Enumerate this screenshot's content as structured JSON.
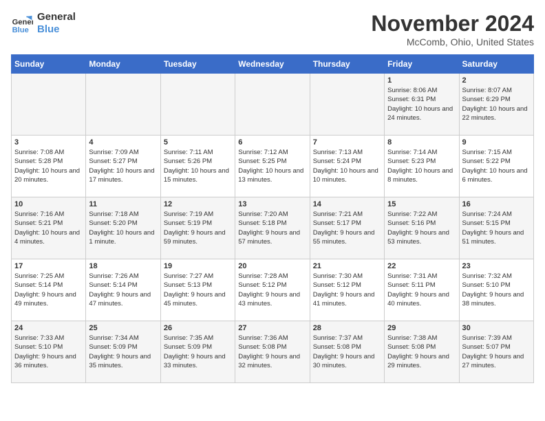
{
  "header": {
    "logo_line1": "General",
    "logo_line2": "Blue",
    "title": "November 2024",
    "subtitle": "McComb, Ohio, United States"
  },
  "calendar": {
    "days_of_week": [
      "Sunday",
      "Monday",
      "Tuesday",
      "Wednesday",
      "Thursday",
      "Friday",
      "Saturday"
    ],
    "weeks": [
      [
        {
          "day": "",
          "info": ""
        },
        {
          "day": "",
          "info": ""
        },
        {
          "day": "",
          "info": ""
        },
        {
          "day": "",
          "info": ""
        },
        {
          "day": "",
          "info": ""
        },
        {
          "day": "1",
          "info": "Sunrise: 8:06 AM\nSunset: 6:31 PM\nDaylight: 10 hours and 24 minutes."
        },
        {
          "day": "2",
          "info": "Sunrise: 8:07 AM\nSunset: 6:29 PM\nDaylight: 10 hours and 22 minutes."
        }
      ],
      [
        {
          "day": "3",
          "info": "Sunrise: 7:08 AM\nSunset: 5:28 PM\nDaylight: 10 hours and 20 minutes."
        },
        {
          "day": "4",
          "info": "Sunrise: 7:09 AM\nSunset: 5:27 PM\nDaylight: 10 hours and 17 minutes."
        },
        {
          "day": "5",
          "info": "Sunrise: 7:11 AM\nSunset: 5:26 PM\nDaylight: 10 hours and 15 minutes."
        },
        {
          "day": "6",
          "info": "Sunrise: 7:12 AM\nSunset: 5:25 PM\nDaylight: 10 hours and 13 minutes."
        },
        {
          "day": "7",
          "info": "Sunrise: 7:13 AM\nSunset: 5:24 PM\nDaylight: 10 hours and 10 minutes."
        },
        {
          "day": "8",
          "info": "Sunrise: 7:14 AM\nSunset: 5:23 PM\nDaylight: 10 hours and 8 minutes."
        },
        {
          "day": "9",
          "info": "Sunrise: 7:15 AM\nSunset: 5:22 PM\nDaylight: 10 hours and 6 minutes."
        }
      ],
      [
        {
          "day": "10",
          "info": "Sunrise: 7:16 AM\nSunset: 5:21 PM\nDaylight: 10 hours and 4 minutes."
        },
        {
          "day": "11",
          "info": "Sunrise: 7:18 AM\nSunset: 5:20 PM\nDaylight: 10 hours and 1 minute."
        },
        {
          "day": "12",
          "info": "Sunrise: 7:19 AM\nSunset: 5:19 PM\nDaylight: 9 hours and 59 minutes."
        },
        {
          "day": "13",
          "info": "Sunrise: 7:20 AM\nSunset: 5:18 PM\nDaylight: 9 hours and 57 minutes."
        },
        {
          "day": "14",
          "info": "Sunrise: 7:21 AM\nSunset: 5:17 PM\nDaylight: 9 hours and 55 minutes."
        },
        {
          "day": "15",
          "info": "Sunrise: 7:22 AM\nSunset: 5:16 PM\nDaylight: 9 hours and 53 minutes."
        },
        {
          "day": "16",
          "info": "Sunrise: 7:24 AM\nSunset: 5:15 PM\nDaylight: 9 hours and 51 minutes."
        }
      ],
      [
        {
          "day": "17",
          "info": "Sunrise: 7:25 AM\nSunset: 5:14 PM\nDaylight: 9 hours and 49 minutes."
        },
        {
          "day": "18",
          "info": "Sunrise: 7:26 AM\nSunset: 5:14 PM\nDaylight: 9 hours and 47 minutes."
        },
        {
          "day": "19",
          "info": "Sunrise: 7:27 AM\nSunset: 5:13 PM\nDaylight: 9 hours and 45 minutes."
        },
        {
          "day": "20",
          "info": "Sunrise: 7:28 AM\nSunset: 5:12 PM\nDaylight: 9 hours and 43 minutes."
        },
        {
          "day": "21",
          "info": "Sunrise: 7:30 AM\nSunset: 5:12 PM\nDaylight: 9 hours and 41 minutes."
        },
        {
          "day": "22",
          "info": "Sunrise: 7:31 AM\nSunset: 5:11 PM\nDaylight: 9 hours and 40 minutes."
        },
        {
          "day": "23",
          "info": "Sunrise: 7:32 AM\nSunset: 5:10 PM\nDaylight: 9 hours and 38 minutes."
        }
      ],
      [
        {
          "day": "24",
          "info": "Sunrise: 7:33 AM\nSunset: 5:10 PM\nDaylight: 9 hours and 36 minutes."
        },
        {
          "day": "25",
          "info": "Sunrise: 7:34 AM\nSunset: 5:09 PM\nDaylight: 9 hours and 35 minutes."
        },
        {
          "day": "26",
          "info": "Sunrise: 7:35 AM\nSunset: 5:09 PM\nDaylight: 9 hours and 33 minutes."
        },
        {
          "day": "27",
          "info": "Sunrise: 7:36 AM\nSunset: 5:08 PM\nDaylight: 9 hours and 32 minutes."
        },
        {
          "day": "28",
          "info": "Sunrise: 7:37 AM\nSunset: 5:08 PM\nDaylight: 9 hours and 30 minutes."
        },
        {
          "day": "29",
          "info": "Sunrise: 7:38 AM\nSunset: 5:08 PM\nDaylight: 9 hours and 29 minutes."
        },
        {
          "day": "30",
          "info": "Sunrise: 7:39 AM\nSunset: 5:07 PM\nDaylight: 9 hours and 27 minutes."
        }
      ]
    ]
  }
}
